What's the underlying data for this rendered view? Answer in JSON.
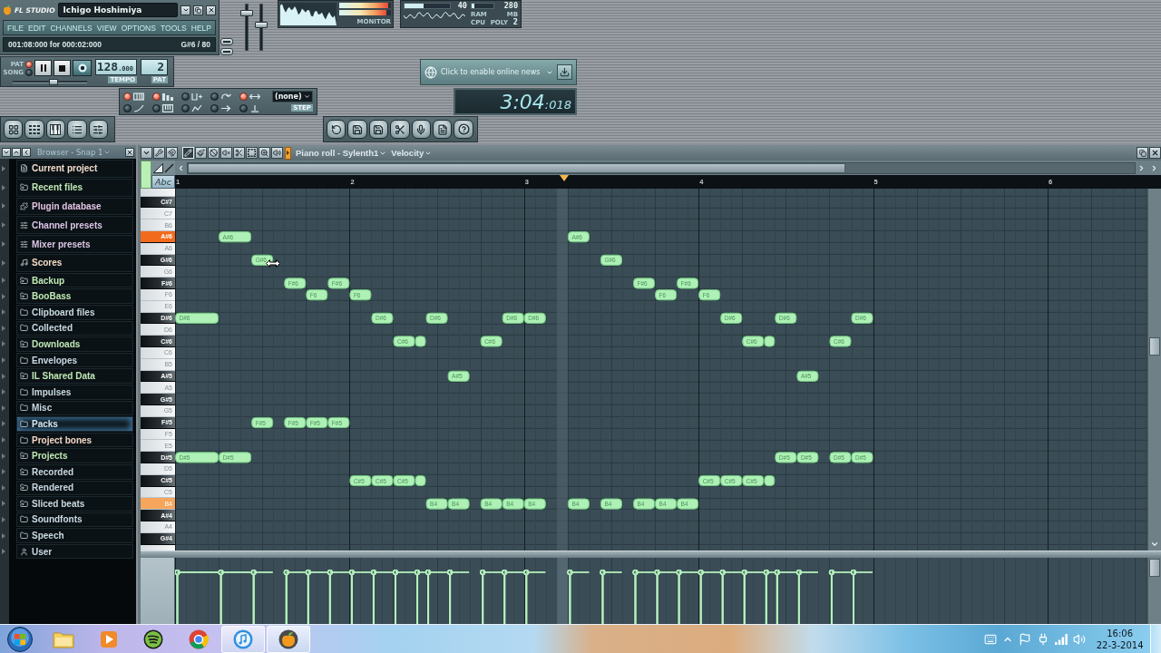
{
  "title_panel": {
    "logo": "FL STUDIO",
    "title": "Ichigo Hoshimiya"
  },
  "menu": [
    "FILE",
    "EDIT",
    "CHANNELS",
    "VIEW",
    "OPTIONS",
    "TOOLS",
    "HELP"
  ],
  "hint_bar": {
    "text": "001:08:000 for 000:02:000",
    "value": "G#6 / 80"
  },
  "master_sliders": [
    {
      "level": 0.86
    },
    {
      "level": 0.55
    }
  ],
  "monitor": {
    "label": "MONITOR",
    "peaks": [
      {
        "level": 0.95
      },
      {
        "level": 0.92
      }
    ]
  },
  "performance": {
    "cpu": {
      "value": "40",
      "level": 0.42
    },
    "ram": {
      "value": "280",
      "level": 0.12
    },
    "labels": [
      "RAM",
      "MB",
      "CPU",
      "POLY"
    ],
    "poly": "2"
  },
  "transport": {
    "modes": [
      {
        "label": "PAT",
        "selected": true
      },
      {
        "label": "SONG",
        "selected": false
      }
    ],
    "tempo": {
      "value": "128",
      "fraction": ".000",
      "label": "TEMPO"
    },
    "pattern": {
      "value": "2",
      "label": "PAT"
    },
    "slider": {
      "level": 0.55
    }
  },
  "online_news": {
    "text": "Click to enable online news"
  },
  "recording": {
    "options": [
      {
        "on": true
      },
      {
        "on": true
      },
      {
        "on": false
      },
      {
        "on": false
      },
      {
        "on": true
      },
      {
        "on": false
      },
      {
        "on": false
      },
      {
        "on": false
      },
      {
        "on": false
      },
      {
        "on": false
      }
    ],
    "dropdown": {
      "value": "(none)"
    },
    "step_label": "STEP"
  },
  "time_display": {
    "main": "3:04",
    "small": ":018"
  },
  "browser": {
    "title": "Browser - Snap 1",
    "items": [
      {
        "label": "Current project",
        "kind": "project",
        "color": "#f2dccb",
        "selected": false
      },
      {
        "label": "Recent files",
        "kind": "recent",
        "color": "#bfe8b4",
        "selected": false
      },
      {
        "label": "Plugin database",
        "kind": "plugins",
        "color": "#e2c3e2",
        "selected": false
      },
      {
        "label": "Channel presets",
        "kind": "presets",
        "color": "#dcc6e6",
        "selected": false
      },
      {
        "label": "Mixer presets",
        "kind": "presets",
        "color": "#dcc6e6",
        "selected": false
      },
      {
        "label": "Scores",
        "kind": "scores",
        "color": "#f2dcc4",
        "selected": false
      },
      {
        "label": "Backup",
        "kind": "shortcut",
        "color": "#bfe8b4",
        "selected": false
      },
      {
        "label": "BooBass",
        "kind": "linked",
        "color": "#bfe8b4",
        "selected": false
      },
      {
        "label": "Clipboard files",
        "kind": "folder",
        "color": "#c9d9e2",
        "selected": false
      },
      {
        "label": "Collected",
        "kind": "folder",
        "color": "#c9d9e2",
        "selected": false
      },
      {
        "label": "Downloads",
        "kind": "linked",
        "color": "#bfe8b4",
        "selected": false
      },
      {
        "label": "Envelopes",
        "kind": "folder",
        "color": "#c9d9e2",
        "selected": false
      },
      {
        "label": "IL Shared Data",
        "kind": "linked",
        "color": "#bfe8b4",
        "selected": false
      },
      {
        "label": "Impulses",
        "kind": "folder",
        "color": "#c9d9e2",
        "selected": false
      },
      {
        "label": "Misc",
        "kind": "folder",
        "color": "#c9d9e2",
        "selected": false
      },
      {
        "label": "Packs",
        "kind": "folder",
        "color": "#d6e6f2",
        "selected": true
      },
      {
        "label": "Project bones",
        "kind": "folder",
        "color": "#f2d6c6",
        "selected": false
      },
      {
        "label": "Projects",
        "kind": "linked",
        "color": "#bfe8b4",
        "selected": false
      },
      {
        "label": "Recorded",
        "kind": "shortcut",
        "color": "#c9d9e2",
        "selected": false
      },
      {
        "label": "Rendered",
        "kind": "shortcut",
        "color": "#c9d9e2",
        "selected": false
      },
      {
        "label": "Sliced beats",
        "kind": "shortcut",
        "color": "#c9d9e2",
        "selected": false
      },
      {
        "label": "Soundfonts",
        "kind": "folder",
        "color": "#c9d9e2",
        "selected": false
      },
      {
        "label": "Speech",
        "kind": "folder",
        "color": "#c9d9e2",
        "selected": false
      },
      {
        "label": "User",
        "kind": "user",
        "color": "#c9d9e2",
        "selected": false
      }
    ]
  },
  "piano_roll": {
    "title": "Piano roll - Sylenth1",
    "lane": "Velocity",
    "tools": [
      {
        "kind": "draw",
        "selected": true
      },
      {
        "kind": "paint",
        "selected": false
      },
      {
        "kind": "delete",
        "selected": false
      },
      {
        "kind": "mute",
        "selected": false
      },
      {
        "kind": "slice",
        "selected": false
      },
      {
        "kind": "select",
        "selected": false
      },
      {
        "kind": "zoom",
        "selected": false
      },
      {
        "kind": "playback",
        "selected": false
      }
    ],
    "note_names_button": "Abc",
    "keys": [
      {
        "kind": "white"
      },
      {
        "kind": "black"
      },
      {
        "kind": "white"
      },
      {
        "kind": "white"
      },
      {
        "kind": "black",
        "color": "#f26b1d",
        "note_labels": [
          "A#6",
          "A#6"
        ]
      },
      {
        "kind": "white"
      },
      {
        "kind": "black",
        "note_labels": [
          "G#6",
          "G#6"
        ]
      },
      {
        "kind": "white"
      },
      {
        "kind": "black",
        "note_labels": [
          "F#6",
          "F#6",
          "F#6",
          "F#6"
        ]
      },
      {
        "kind": "white",
        "note_labels": [
          "F6",
          "F6",
          "F6",
          "F6"
        ]
      },
      {
        "kind": "white"
      },
      {
        "kind": "black",
        "note_labels": [
          "D#6",
          "D#6",
          "D#6",
          "D#6",
          "D#6",
          "D#6",
          "D#6",
          "D#6"
        ]
      },
      {
        "kind": "white"
      },
      {
        "kind": "black",
        "note_labels": [
          "C#6",
          "C#6",
          "C#6",
          "C#6"
        ]
      },
      {
        "kind": "white"
      },
      {
        "kind": "white"
      },
      {
        "kind": "black",
        "note_labels": [
          "A#5",
          "A#5"
        ]
      },
      {
        "kind": "white"
      },
      {
        "kind": "black"
      },
      {
        "kind": "white"
      },
      {
        "kind": "black",
        "note_labels": [
          "F#5",
          "F#5",
          "F#5",
          "F#5"
        ]
      },
      {
        "kind": "white"
      },
      {
        "kind": "white"
      },
      {
        "kind": "black",
        "note_labels": [
          "D#5",
          "D#5",
          "D#5",
          "D#5",
          "D#5",
          "D#5"
        ]
      },
      {
        "kind": "white"
      },
      {
        "kind": "black",
        "note_labels": [
          "C#5",
          "C#5",
          "C#5",
          "C#5",
          "C#5",
          "C#5"
        ]
      },
      {
        "kind": "white"
      },
      {
        "kind": "white",
        "color": "#f5a55c",
        "note_labels": [
          "B4",
          "B4",
          "B4",
          "B4",
          "B4",
          "B4",
          "B4",
          "B4",
          "B4",
          "B4"
        ]
      },
      {
        "kind": "black"
      },
      {
        "kind": "white"
      },
      {
        "kind": "black"
      },
      {
        "kind": "white"
      }
    ],
    "chart_data": [
      {
        "type": "bar",
        "orientation": "horizontal",
        "color": "#aef0b6",
        "categories": [
          null,
          "C#7",
          "C7",
          "B6",
          "A#6",
          "A6",
          "G#6",
          "G6",
          "F#6",
          "F6",
          "E6",
          "D#6",
          "D6",
          "C#6",
          "C6",
          "B5",
          "A#5",
          "A5",
          "G#5",
          "G5",
          "F#5",
          "F5",
          "E5",
          "D#5",
          "D5",
          "C#5",
          "C5",
          "B4",
          "A#4",
          "A4",
          "G#4",
          null
        ],
        "xticks": [
          1,
          2,
          3,
          4,
          5,
          6
        ],
        "xlim": [
          1,
          6.572
        ],
        "bands": [
          {
            "axis": "x",
            "from": 3.1875,
            "to": 3.25
          }
        ],
        "series": [
          {
            "base": [
              null,
              null,
              null,
              null,
              1.25,
              null,
              1.4375,
              null,
              1.625,
              1.75,
              null,
              1,
              null,
              2.25,
              null,
              null,
              2.5625,
              null,
              null,
              null,
              1.4375,
              null,
              null,
              1,
              null,
              2,
              null,
              2.4375,
              null,
              null,
              null,
              null
            ],
            "values": [
              null,
              null,
              null,
              null,
              0.1875,
              null,
              0.125,
              null,
              0.125,
              0.125,
              null,
              0.25,
              null,
              0.125,
              null,
              null,
              0.125,
              null,
              null,
              null,
              0.125,
              null,
              null,
              0.25,
              null,
              0.125,
              null,
              0.125,
              null,
              null,
              null,
              null
            ]
          },
          {
            "base": [
              null,
              null,
              null,
              null,
              3.25,
              null,
              3.4375,
              null,
              1.875,
              2,
              null,
              2.125,
              null,
              2.375,
              null,
              null,
              4.5625,
              null,
              null,
              null,
              1.625,
              null,
              null,
              1.25,
              null,
              2.125,
              null,
              2.5625,
              null,
              null,
              null,
              null
            ],
            "values": [
              null,
              null,
              null,
              null,
              0.125,
              null,
              0.125,
              null,
              0.125,
              0.125,
              null,
              0.125,
              null,
              0.0625,
              null,
              null,
              0.125,
              null,
              null,
              null,
              0.125,
              null,
              null,
              0.1875,
              null,
              0.125,
              null,
              0.125,
              null,
              null,
              null,
              null
            ]
          },
          {
            "base": [
              null,
              null,
              null,
              null,
              null,
              null,
              null,
              null,
              3.625,
              3.75,
              null,
              2.4375,
              null,
              2.75,
              null,
              null,
              null,
              null,
              null,
              null,
              1.75,
              null,
              null,
              4.4375,
              null,
              2.25,
              null,
              2.75,
              null,
              null,
              null,
              null
            ],
            "values": [
              null,
              null,
              null,
              null,
              null,
              null,
              null,
              null,
              0.125,
              0.125,
              null,
              0.125,
              null,
              0.125,
              null,
              null,
              null,
              null,
              null,
              null,
              0.125,
              null,
              null,
              0.125,
              null,
              0.125,
              null,
              0.125,
              null,
              null,
              null,
              null
            ]
          },
          {
            "base": [
              null,
              null,
              null,
              null,
              null,
              null,
              null,
              null,
              3.875,
              4,
              null,
              2.875,
              null,
              4.25,
              null,
              null,
              null,
              null,
              null,
              null,
              1.875,
              null,
              null,
              4.5625,
              null,
              2.375,
              null,
              2.875,
              null,
              null,
              null,
              null
            ],
            "values": [
              null,
              null,
              null,
              null,
              null,
              null,
              null,
              null,
              0.125,
              0.125,
              null,
              0.125,
              null,
              0.125,
              null,
              null,
              null,
              null,
              null,
              null,
              0.125,
              null,
              null,
              0.125,
              null,
              0.0625,
              null,
              0.125,
              null,
              null,
              null,
              null
            ]
          },
          {
            "base": [
              null,
              null,
              null,
              null,
              null,
              null,
              null,
              null,
              null,
              null,
              null,
              3,
              null,
              4.375,
              null,
              null,
              null,
              null,
              null,
              null,
              null,
              null,
              null,
              4.75,
              null,
              4,
              null,
              3,
              null,
              null,
              null,
              null
            ],
            "values": [
              null,
              null,
              null,
              null,
              null,
              null,
              null,
              null,
              null,
              null,
              null,
              0.125,
              null,
              0.0625,
              null,
              null,
              null,
              null,
              null,
              null,
              null,
              null,
              null,
              0.125,
              null,
              0.125,
              null,
              0.125,
              null,
              null,
              null,
              null
            ]
          },
          {
            "base": [
              null,
              null,
              null,
              null,
              null,
              null,
              null,
              null,
              null,
              null,
              null,
              4.125,
              null,
              4.75,
              null,
              null,
              null,
              null,
              null,
              null,
              null,
              null,
              null,
              4.875,
              null,
              4.125,
              null,
              3.25,
              null,
              null,
              null,
              null
            ],
            "values": [
              null,
              null,
              null,
              null,
              null,
              null,
              null,
              null,
              null,
              null,
              null,
              0.125,
              null,
              0.125,
              null,
              null,
              null,
              null,
              null,
              null,
              null,
              null,
              null,
              0.125,
              null,
              0.125,
              null,
              0.125,
              null,
              null,
              null,
              null
            ]
          },
          {
            "base": [
              null,
              null,
              null,
              null,
              null,
              null,
              null,
              null,
              null,
              null,
              null,
              4.4375,
              null,
              null,
              null,
              null,
              null,
              null,
              null,
              null,
              null,
              null,
              null,
              null,
              null,
              4.25,
              null,
              3.4375,
              null,
              null,
              null,
              null
            ],
            "values": [
              null,
              null,
              null,
              null,
              null,
              null,
              null,
              null,
              null,
              null,
              null,
              0.125,
              null,
              null,
              null,
              null,
              null,
              null,
              null,
              null,
              null,
              null,
              null,
              null,
              null,
              0.125,
              null,
              0.125,
              null,
              null,
              null,
              null
            ]
          },
          {
            "base": [
              null,
              null,
              null,
              null,
              null,
              null,
              null,
              null,
              null,
              null,
              null,
              4.875,
              null,
              null,
              null,
              null,
              null,
              null,
              null,
              null,
              null,
              null,
              null,
              null,
              null,
              4.375,
              null,
              3.625,
              null,
              null,
              null,
              null
            ],
            "values": [
              null,
              null,
              null,
              null,
              null,
              null,
              null,
              null,
              null,
              null,
              null,
              0.125,
              null,
              null,
              null,
              null,
              null,
              null,
              null,
              null,
              null,
              null,
              null,
              null,
              null,
              0.0625,
              null,
              0.125,
              null,
              null,
              null,
              null
            ]
          },
          {
            "base": [
              null,
              null,
              null,
              null,
              null,
              null,
              null,
              null,
              null,
              null,
              null,
              null,
              null,
              null,
              null,
              null,
              null,
              null,
              null,
              null,
              null,
              null,
              null,
              null,
              null,
              null,
              null,
              3.75,
              null,
              null,
              null,
              null
            ],
            "values": [
              null,
              null,
              null,
              null,
              null,
              null,
              null,
              null,
              null,
              null,
              null,
              null,
              null,
              null,
              null,
              null,
              null,
              null,
              null,
              null,
              null,
              null,
              null,
              null,
              null,
              null,
              null,
              0.125,
              null,
              null,
              null,
              null
            ]
          },
          {
            "base": [
              null,
              null,
              null,
              null,
              null,
              null,
              null,
              null,
              null,
              null,
              null,
              null,
              null,
              null,
              null,
              null,
              null,
              null,
              null,
              null,
              null,
              null,
              null,
              null,
              null,
              null,
              null,
              3.875,
              null,
              null,
              null,
              null
            ],
            "values": [
              null,
              null,
              null,
              null,
              null,
              null,
              null,
              null,
              null,
              null,
              null,
              null,
              null,
              null,
              null,
              null,
              null,
              null,
              null,
              null,
              null,
              null,
              null,
              null,
              null,
              null,
              null,
              0.125,
              null,
              null,
              null,
              null
            ]
          }
        ]
      }
    ]
  },
  "taskbar": {
    "apps": [
      {
        "kind": "files",
        "open": false
      },
      {
        "kind": "media",
        "open": false
      },
      {
        "kind": "streaming",
        "open": false
      },
      {
        "kind": "web",
        "open": false
      },
      {
        "kind": "music",
        "open": true
      },
      {
        "kind": "daw",
        "open": true
      }
    ],
    "time": "16:06",
    "date": "22-3-2014"
  }
}
